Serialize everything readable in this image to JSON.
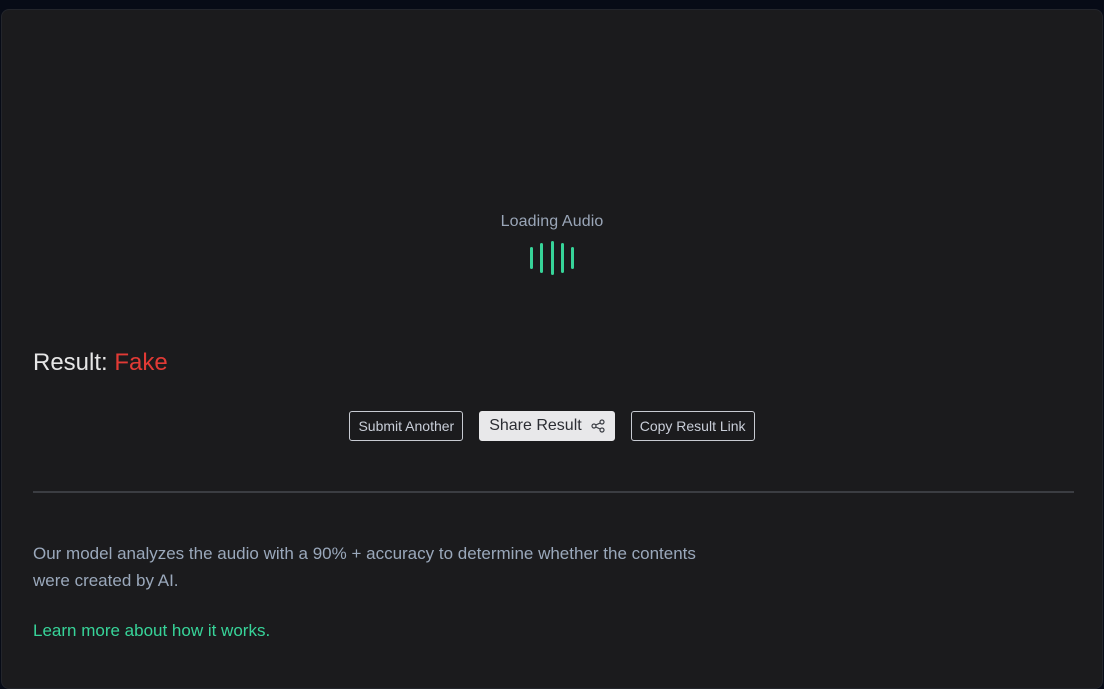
{
  "colors": {
    "accent": "#37d499",
    "bad": "#e23a35"
  },
  "loader": {
    "label": "Loading Audio",
    "icon": "audio-wave-icon"
  },
  "result": {
    "prefix": "Result:",
    "verdict": "Fake"
  },
  "actions": {
    "submit_label": "Submit Another",
    "share_label": "Share Result",
    "share_icon": "share-icon",
    "copy_label": "Copy Result Link"
  },
  "info": {
    "description": "Our model analyzes the audio with a 90% + accuracy to determine whether the contents were created by AI.",
    "learn_more": "Learn more about how it works."
  }
}
